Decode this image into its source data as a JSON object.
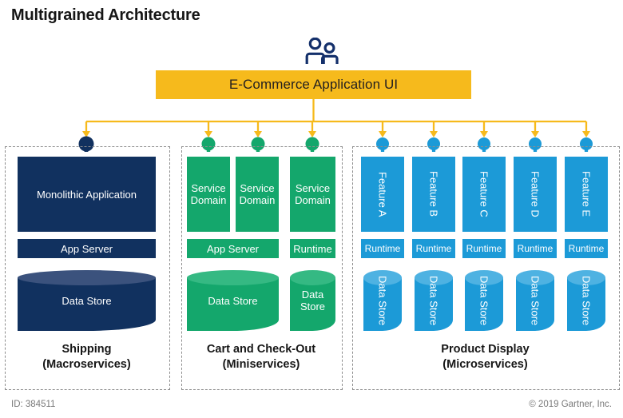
{
  "title": "Multigrained Architecture",
  "icon": {
    "users": "users-icon"
  },
  "banner": {
    "label": "E-Commerce Application UI",
    "color": "#f6ba1c"
  },
  "colors": {
    "navy": "#11315f",
    "green": "#14a76c",
    "blue": "#1c9ad7",
    "amber": "#f6ba1c",
    "dash": "#8d8d8d"
  },
  "groups": [
    {
      "id": "shipping",
      "title": "Shipping",
      "subtitle": "(Macroservices)",
      "tier_color": "#11315f",
      "app_blocks": [
        {
          "label": "Monolithic Application"
        }
      ],
      "platform_blocks": [
        {
          "label": "App Server"
        }
      ],
      "stores": [
        {
          "label": "Data Store"
        }
      ]
    },
    {
      "id": "cart-and-check-out",
      "title": "Cart and Check-Out",
      "subtitle": "(Miniservices)",
      "tier_color": "#14a76c",
      "app_blocks": [
        {
          "label": "Service Domain"
        },
        {
          "label": "Service Domain"
        },
        {
          "label": "Service Domain"
        }
      ],
      "platform_blocks": [
        {
          "label": "App Server"
        },
        {
          "label": "Runtime"
        }
      ],
      "stores": [
        {
          "label": "Data Store"
        },
        {
          "label": "Data Store"
        }
      ]
    },
    {
      "id": "product-display",
      "title": "Product Display",
      "subtitle": "(Microservices)",
      "tier_color": "#1c9ad7",
      "app_blocks": [
        {
          "label": "Feature A"
        },
        {
          "label": "Feature B"
        },
        {
          "label": "Feature C"
        },
        {
          "label": "Feature D"
        },
        {
          "label": "Feature E"
        }
      ],
      "platform_blocks": [
        {
          "label": "Runtime"
        },
        {
          "label": "Runtime"
        },
        {
          "label": "Runtime"
        },
        {
          "label": "Runtime"
        },
        {
          "label": "Runtime"
        }
      ],
      "stores": [
        {
          "label": "Data Store"
        },
        {
          "label": "Data Store"
        },
        {
          "label": "Data Store"
        },
        {
          "label": "Data Store"
        },
        {
          "label": "Data Store"
        }
      ]
    }
  ],
  "footer": {
    "id_label": "ID: 384511",
    "copyright": "© 2019 Gartner, Inc."
  }
}
